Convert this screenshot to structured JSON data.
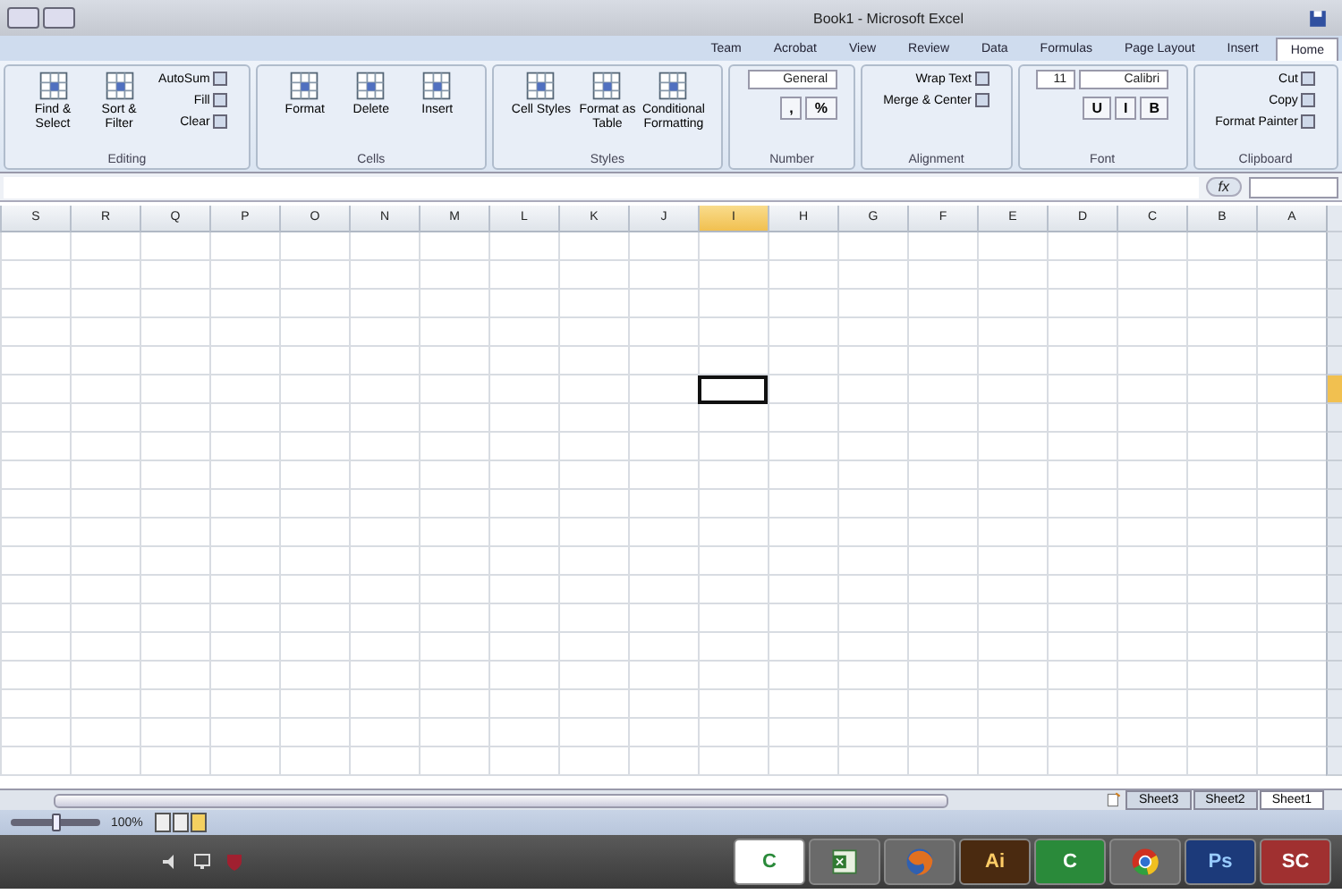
{
  "window": {
    "title": "Book1 - Microsoft Excel"
  },
  "tabs": [
    {
      "label": "Team",
      "selected": false
    },
    {
      "label": "Acrobat",
      "selected": false
    },
    {
      "label": "View",
      "selected": false
    },
    {
      "label": "Review",
      "selected": false
    },
    {
      "label": "Data",
      "selected": false
    },
    {
      "label": "Formulas",
      "selected": false
    },
    {
      "label": "Page Layout",
      "selected": false
    },
    {
      "label": "Insert",
      "selected": false
    },
    {
      "label": "Home",
      "selected": true
    }
  ],
  "ribbon": [
    {
      "label": "Editing",
      "items": [
        {
          "kind": "large",
          "label": "Find & Select"
        },
        {
          "kind": "large",
          "label": "Sort & Filter"
        },
        {
          "kind": "small",
          "label": "AutoSum"
        },
        {
          "kind": "small",
          "label": "Fill"
        },
        {
          "kind": "small",
          "label": "Clear"
        }
      ]
    },
    {
      "label": "Cells",
      "items": [
        {
          "kind": "large",
          "label": "Format"
        },
        {
          "kind": "large",
          "label": "Delete"
        },
        {
          "kind": "large",
          "label": "Insert"
        }
      ]
    },
    {
      "label": "Styles",
      "items": [
        {
          "kind": "large",
          "label": "Cell Styles"
        },
        {
          "kind": "large",
          "label": "Format as Table"
        },
        {
          "kind": "large",
          "label": "Conditional Formatting"
        }
      ]
    },
    {
      "label": "Number",
      "items": [
        {
          "kind": "combo",
          "label": "General"
        },
        {
          "kind": "glyph",
          "label": ","
        },
        {
          "kind": "glyph",
          "label": "%"
        }
      ]
    },
    {
      "label": "Alignment",
      "items": [
        {
          "kind": "small",
          "label": "Wrap Text"
        },
        {
          "kind": "small",
          "label": "Merge & Center"
        }
      ]
    },
    {
      "label": "Font",
      "items": [
        {
          "kind": "combo",
          "label": "11"
        },
        {
          "kind": "combo",
          "label": "Calibri"
        },
        {
          "kind": "glyph",
          "label": "U"
        },
        {
          "kind": "glyph",
          "label": "I"
        },
        {
          "kind": "glyph",
          "label": "B"
        }
      ]
    },
    {
      "label": "Clipboard",
      "items": [
        {
          "kind": "small",
          "label": "Cut"
        },
        {
          "kind": "small",
          "label": "Copy"
        },
        {
          "kind": "small",
          "label": "Format Painter"
        }
      ]
    }
  ],
  "formula_bar": {
    "fx": "fx"
  },
  "columns": [
    {
      "label": "S",
      "selected": false
    },
    {
      "label": "R",
      "selected": false
    },
    {
      "label": "Q",
      "selected": false
    },
    {
      "label": "P",
      "selected": false
    },
    {
      "label": "O",
      "selected": false
    },
    {
      "label": "N",
      "selected": false
    },
    {
      "label": "M",
      "selected": false
    },
    {
      "label": "L",
      "selected": false
    },
    {
      "label": "K",
      "selected": false
    },
    {
      "label": "J",
      "selected": false
    },
    {
      "label": "I",
      "selected": true
    },
    {
      "label": "H",
      "selected": false
    },
    {
      "label": "G",
      "selected": false
    },
    {
      "label": "F",
      "selected": false
    },
    {
      "label": "E",
      "selected": false
    },
    {
      "label": "D",
      "selected": false
    },
    {
      "label": "C",
      "selected": false
    },
    {
      "label": "B",
      "selected": false
    },
    {
      "label": "A",
      "selected": false
    }
  ],
  "rows": [
    {
      "selected": false
    },
    {
      "selected": false
    },
    {
      "selected": false
    },
    {
      "selected": false
    },
    {
      "selected": false
    },
    {
      "selected": true
    },
    {
      "selected": false
    },
    {
      "selected": false
    },
    {
      "selected": false
    },
    {
      "selected": false
    },
    {
      "selected": false
    },
    {
      "selected": false
    },
    {
      "selected": false
    },
    {
      "selected": false
    },
    {
      "selected": false
    },
    {
      "selected": false
    },
    {
      "selected": false
    },
    {
      "selected": false
    },
    {
      "selected": false
    }
  ],
  "sheets": [
    {
      "label": "Sheet3",
      "selected": false
    },
    {
      "label": "Sheet2",
      "selected": false
    },
    {
      "label": "Sheet1",
      "selected": true
    }
  ],
  "status_bar": {
    "zoom_slider": {
      "level": 0.5
    },
    "zoom": "100%"
  },
  "taskbar": [
    {
      "kind": "cw",
      "label": "C"
    },
    {
      "kind": "excel"
    },
    {
      "kind": "firefox"
    },
    {
      "kind": "ai",
      "label": "Ai"
    },
    {
      "kind": "c",
      "label": "C"
    },
    {
      "kind": "chrome"
    },
    {
      "kind": "ps",
      "label": "Ps"
    },
    {
      "kind": "sc",
      "label": "SC"
    }
  ]
}
